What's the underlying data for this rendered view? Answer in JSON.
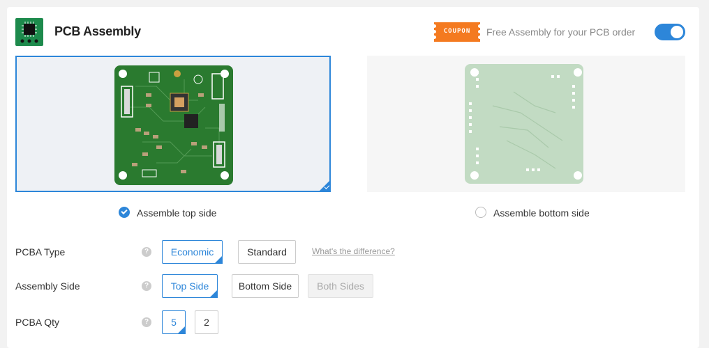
{
  "header": {
    "title": "PCB Assembly",
    "coupon_label": "COUPON",
    "coupon_message": "Free Assembly for your PCB order",
    "toggle_on": true
  },
  "sides": {
    "top_label": "Assemble top side",
    "bottom_label": "Assemble bottom side",
    "selected": "top"
  },
  "form": {
    "pcba_type": {
      "label": "PCBA Type",
      "options": [
        "Economic",
        "Standard"
      ],
      "selected": "Economic",
      "link": "What's the difference?"
    },
    "assembly_side": {
      "label": "Assembly Side",
      "options": [
        "Top Side",
        "Bottom Side",
        "Both Sides"
      ],
      "selected": "Top Side",
      "disabled": [
        "Both Sides"
      ]
    },
    "pcba_qty": {
      "label": "PCBA Qty",
      "options": [
        "5",
        "2"
      ],
      "selected": "5"
    }
  },
  "colors": {
    "accent": "#2d86d9",
    "coupon": "#f47a20",
    "pcb_top": "#2a7a2f",
    "pcb_bottom": "#c2dbc3"
  }
}
